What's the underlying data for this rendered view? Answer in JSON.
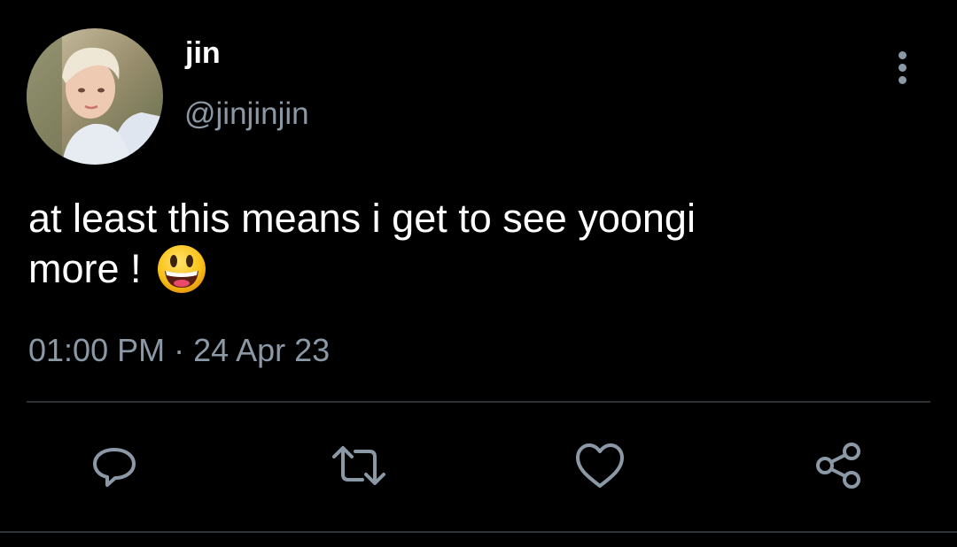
{
  "tweet": {
    "author_name": "jin",
    "author_handle": "@jinjinjin",
    "text": "at least this means i get to see yoongi\nmore ! ",
    "emoji": "grinning-face",
    "timestamp": "01:00 PM · 24 Apr 23"
  },
  "actions": [
    {
      "icon": "reply-icon"
    },
    {
      "icon": "retweet-icon"
    },
    {
      "icon": "like-icon"
    },
    {
      "icon": "share-icon"
    }
  ],
  "colors": {
    "background": "#000000",
    "text_primary": "#ffffff",
    "text_secondary": "#8b98a5",
    "divider": "#2f3336"
  }
}
